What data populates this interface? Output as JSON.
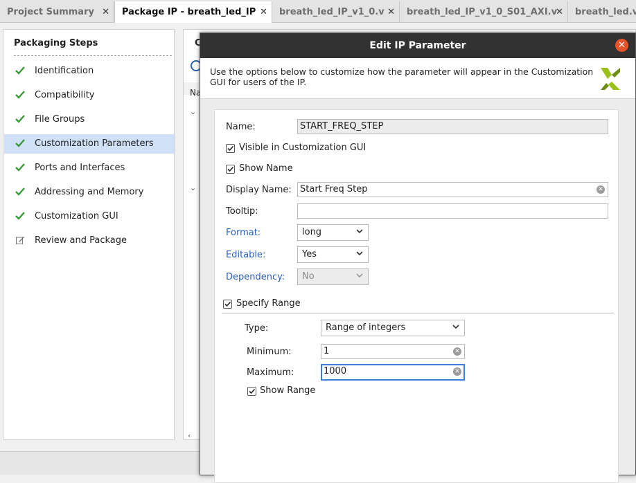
{
  "tabs": [
    {
      "label": "Project Summary"
    },
    {
      "label": "Package IP - breath_led_IP"
    },
    {
      "label": "breath_led_IP_v1_0.v"
    },
    {
      "label": "breath_led_IP_v1_0_S01_AXI.v"
    },
    {
      "label": "breath_led.v"
    }
  ],
  "left_panel": {
    "title": "Packaging Steps",
    "steps": [
      {
        "label": "Identification",
        "status": "done"
      },
      {
        "label": "Compatibility",
        "status": "done"
      },
      {
        "label": "File Groups",
        "status": "done"
      },
      {
        "label": "Customization Parameters",
        "status": "done",
        "selected": true
      },
      {
        "label": "Ports and Interfaces",
        "status": "done"
      },
      {
        "label": "Addressing and Memory",
        "status": "done"
      },
      {
        "label": "Customization GUI",
        "status": "done"
      },
      {
        "label": "Review and Package",
        "status": "edit"
      }
    ]
  },
  "background_panel": {
    "header_fragment": "C",
    "column_fragment": "Na"
  },
  "dialog": {
    "title": "Edit IP Parameter",
    "description": "Use the options below to customize how the parameter will appear in the Customization GUI for users of the IP.",
    "name_label": "Name:",
    "name_value": "START_FREQ_STEP",
    "visible_label": "Visible in Customization GUI",
    "visible_checked": true,
    "show_name_label": "Show Name",
    "show_name_checked": true,
    "display_name_label": "Display Name:",
    "display_name_value": "Start Freq Step",
    "tooltip_label": "Tooltip:",
    "tooltip_value": "",
    "format_label": "Format:",
    "format_value": "long",
    "editable_label": "Editable:",
    "editable_value": "Yes",
    "dependency_label": "Dependency:",
    "dependency_value": "No",
    "specify_range_label": "Specify Range",
    "specify_range_checked": true,
    "type_label": "Type:",
    "type_value": "Range of integers",
    "minimum_label": "Minimum:",
    "minimum_value": "1",
    "maximum_label": "Maximum:",
    "maximum_value": "1000",
    "show_range_label": "Show Range",
    "show_range_checked": true
  },
  "colors": {
    "accent": "#3d7fd6",
    "check": "#3a9a3a",
    "close_button": "#e5532b",
    "title_bar": "#323232",
    "selected_row": "#cfe0f7",
    "link_label": "#2b5fb8"
  }
}
